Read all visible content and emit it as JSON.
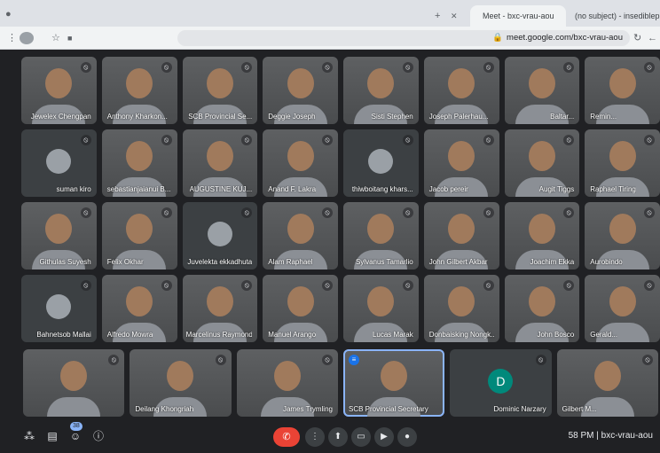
{
  "browser": {
    "tabs": [
      {
        "title": "Meet - bxc-vrau-aou",
        "active": true
      },
      {
        "title": "(no subject) - insedibleppe...",
        "active": false
      }
    ],
    "url": "meet.google.com/bxc-vrau-aou"
  },
  "participants_rows": [
    [
      {
        "name": "Jewelex Chengpan",
        "camera": true
      },
      {
        "name": "Anthony Kharkon...",
        "camera": true
      },
      {
        "name": "SCB Provincial Se...",
        "camera": true
      },
      {
        "name": "Deggie Joseph",
        "camera": true
      },
      {
        "name": "Sisti Stephen",
        "camera": true
      },
      {
        "name": "Joseph Palerhau...",
        "camera": true
      },
      {
        "name": "Baltar...",
        "camera": true
      },
      {
        "name": "Remin...",
        "camera": true
      }
    ],
    [
      {
        "name": "suman kiro",
        "camera": false
      },
      {
        "name": "sebastianjaianui B...",
        "camera": true
      },
      {
        "name": "AUGUSTINE KUJ...",
        "camera": true
      },
      {
        "name": "Anand F. Lakra",
        "camera": true
      },
      {
        "name": "thiwboitang khars...",
        "camera": false
      },
      {
        "name": "Jacob pereir",
        "camera": true
      },
      {
        "name": "Augit Tiggs",
        "camera": true
      },
      {
        "name": "Raphael Tiring",
        "camera": true
      }
    ],
    [
      {
        "name": "Githulas Suyesh",
        "camera": true
      },
      {
        "name": "Felix Okhar",
        "camera": true
      },
      {
        "name": "Juvelekta ekkadhuta",
        "camera": false
      },
      {
        "name": "Alam Raphael",
        "camera": true
      },
      {
        "name": "Sylvanus Tamarlio",
        "camera": true
      },
      {
        "name": "John Gilbert Akbar",
        "camera": true
      },
      {
        "name": "Joachim Ekka",
        "camera": true
      },
      {
        "name": "Aurobindo",
        "camera": true
      }
    ],
    [
      {
        "name": "Bahnetsob Mallai",
        "camera": false
      },
      {
        "name": "Alfredo Mowra",
        "camera": true
      },
      {
        "name": "Marcelinus Raymond",
        "camera": true
      },
      {
        "name": "Manuel Arango",
        "camera": true
      },
      {
        "name": "Lucas Marak",
        "camera": true
      },
      {
        "name": "Donbaisking Nongk...",
        "camera": true
      },
      {
        "name": "John Bosco",
        "camera": true
      },
      {
        "name": "Gerald...",
        "camera": true
      }
    ],
    [
      {
        "name": "",
        "camera": true
      },
      {
        "name": "Deilang Khongriah",
        "camera": true
      },
      {
        "name": "James Trymling",
        "camera": true
      },
      {
        "name": "SCB Provincial Secretary",
        "camera": true,
        "speaking": true
      },
      {
        "name": "Dominic Narzary",
        "camera": false,
        "initial": "D"
      },
      {
        "name": "Gilbert M...",
        "camera": true
      }
    ]
  ],
  "bottom": {
    "meeting_info": "58 PM | bxc-vrau-aou",
    "participant_count": "38"
  },
  "colors": {
    "background": "#202124",
    "tile": "#3c4043",
    "end_call": "#ea4335",
    "speaking_border": "#8ab4f8",
    "avatar_d": "#00897b"
  }
}
